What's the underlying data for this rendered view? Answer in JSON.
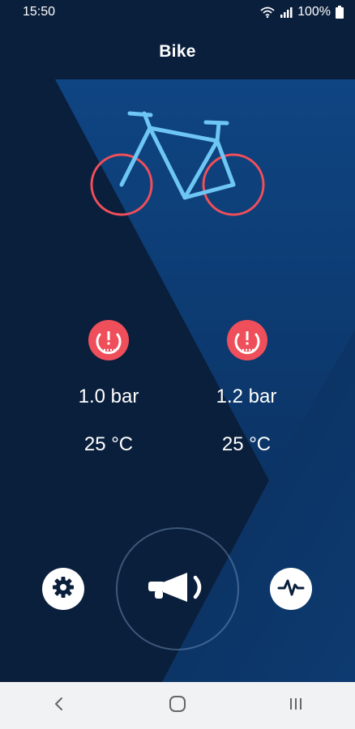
{
  "status_bar": {
    "time": "15:50",
    "battery": "100%",
    "icons": [
      "wifi-icon",
      "signal-icon",
      "battery-icon"
    ]
  },
  "header": {
    "title": "Bike"
  },
  "bike": {
    "frame_color": "#6ec6f5",
    "wheel_color": "#ef4f5a"
  },
  "tires": [
    {
      "position": "front",
      "pressure": "1.0 bar",
      "temperature": "25 °C",
      "icon": "tire-pressure-warning-icon",
      "status_color": "#ef4f5a"
    },
    {
      "position": "rear",
      "pressure": "1.2 bar",
      "temperature": "25 °C",
      "icon": "tire-pressure-warning-icon",
      "status_color": "#ef4f5a"
    }
  ],
  "controls": {
    "left": "settings-gear-icon",
    "center": "horn-icon",
    "right": "activity-pulse-icon"
  },
  "nav": [
    "back-icon",
    "home-icon",
    "recents-icon"
  ],
  "colors": {
    "background": "#0a1f3c",
    "panel_light": "#0e3a6e",
    "accent": "#ef4f5a",
    "bike_frame": "#6ec6f5"
  }
}
